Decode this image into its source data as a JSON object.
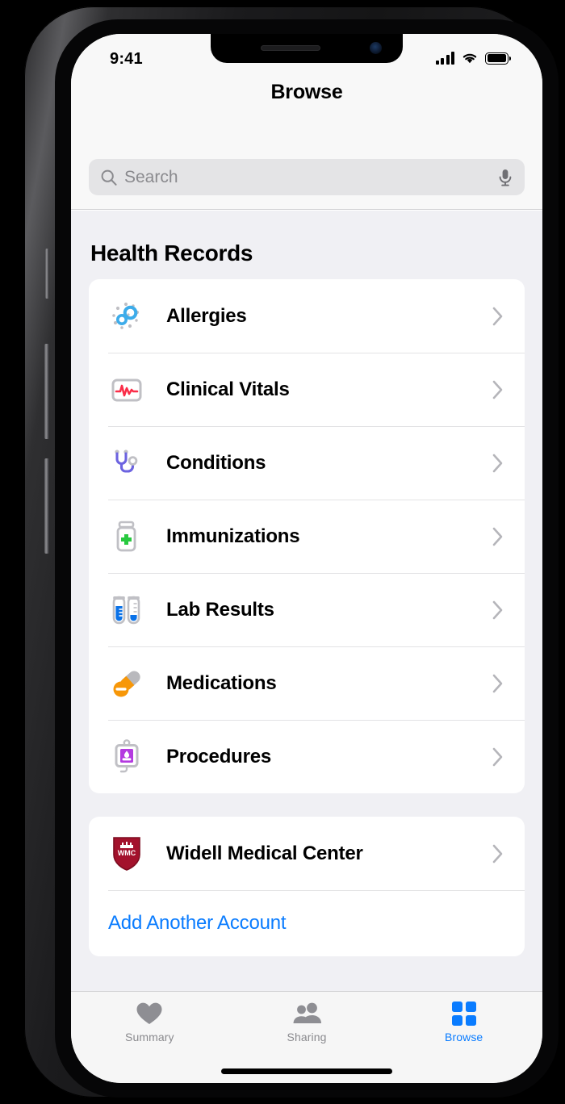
{
  "device": {
    "frame": "iphone",
    "notch_elements": [
      "speaker-grille",
      "front-camera"
    ],
    "side_buttons": [
      "silent-switch",
      "volume-up",
      "volume-down",
      "power-button"
    ]
  },
  "status_bar": {
    "time": "9:41",
    "cellular_icon": "signal-bars-icon",
    "wifi_icon": "wifi-icon",
    "battery_icon": "battery-icon"
  },
  "header": {
    "title": "Browse"
  },
  "search": {
    "placeholder": "Search",
    "value": "",
    "search_icon": "search-icon",
    "mic_icon": "microphone-icon"
  },
  "main": {
    "section_title": "Health Records",
    "records": [
      {
        "label": "Allergies",
        "icon": "allergies-icon",
        "chevron": "chevron-right-icon"
      },
      {
        "label": "Clinical Vitals",
        "icon": "clinical-vitals-icon",
        "chevron": "chevron-right-icon"
      },
      {
        "label": "Conditions",
        "icon": "conditions-icon",
        "chevron": "chevron-right-icon"
      },
      {
        "label": "Immunizations",
        "icon": "immunizations-icon",
        "chevron": "chevron-right-icon"
      },
      {
        "label": "Lab Results",
        "icon": "lab-results-icon",
        "chevron": "chevron-right-icon"
      },
      {
        "label": "Medications",
        "icon": "medications-icon",
        "chevron": "chevron-right-icon"
      },
      {
        "label": "Procedures",
        "icon": "procedures-icon",
        "chevron": "chevron-right-icon"
      }
    ],
    "accounts": [
      {
        "label": "Widell Medical Center",
        "icon": "widell-medical-center-logo",
        "logo_text": "WMC",
        "chevron": "chevron-right-icon"
      }
    ],
    "add_account_label": "Add Another Account"
  },
  "tab_bar": {
    "tabs": [
      {
        "label": "Summary",
        "icon": "heart-icon",
        "active": false
      },
      {
        "label": "Sharing",
        "icon": "people-icon",
        "active": false
      },
      {
        "label": "Browse",
        "icon": "grid-icon",
        "active": true
      }
    ]
  },
  "colors": {
    "accent": "#0a7cff",
    "screen_background": "#f0f0f4",
    "card_background": "#ffffff",
    "nav_background": "#f8f8f8",
    "tab_background": "#f6f6f6",
    "inactive_tab": "#8a8a8e",
    "separator": "#e3e3e5",
    "search_field": "#e4e4e6",
    "allergies_blue": "#3dacea",
    "vitals_red": "#fa2d48",
    "conditions_purple": "#6c63e0",
    "immunization_green": "#28c93f",
    "lab_blue": "#0a72e8",
    "medication_orange": "#f79708",
    "procedure_purple": "#b43ae0",
    "widell_red": "#a3122c",
    "icon_gray": "#b9b9bd"
  }
}
